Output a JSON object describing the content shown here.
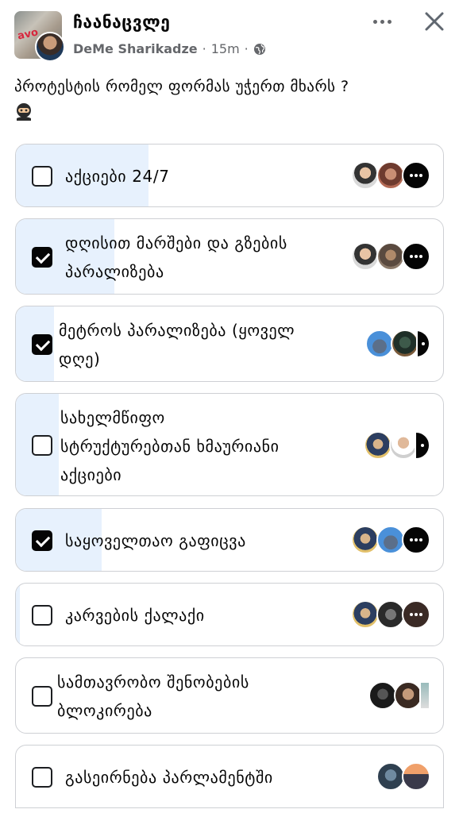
{
  "post": {
    "group_name": "ჩაანაცვლე",
    "author": "DeMe Sharikadze",
    "separator": "·",
    "time": "15m",
    "graffiti": "avo",
    "icons": {
      "visibility": "globe-icon",
      "menu": "more-icon",
      "close": "close-icon",
      "question_emoji": "ninja-icon"
    }
  },
  "question": "პროტესტის რომელ ფორმას უჭერთ მხარს ?",
  "options": [
    {
      "label": "აქციები 24/7",
      "checked": false,
      "share": 0.3
    },
    {
      "label": "დღისით მარშები და გზების პარალიზება",
      "checked": true,
      "share": 0.23
    },
    {
      "label": "მეტროს პარალიზება (ყოველ დღე)",
      "checked": true,
      "share": 0.08
    },
    {
      "label": "სახელმწიფო სტრუქტურებთან ხმაურიანი აქციები",
      "checked": false,
      "share": 0.1
    },
    {
      "label": "საყოველთაო გაფიცვა",
      "checked": true,
      "share": 0.2
    },
    {
      "label": "კარვების ქალაქი",
      "checked": false,
      "share": 0.01
    },
    {
      "label": "სამთავრობო შენობების ბლოკირება",
      "checked": false,
      "share": 0.0
    },
    {
      "label": "გასეირნება პარლამენტში",
      "checked": false,
      "share": 0.0
    }
  ],
  "colors": {
    "accent_fill": "#e7f1fd",
    "border": "#ced0d4",
    "muted_text": "#65676b"
  }
}
